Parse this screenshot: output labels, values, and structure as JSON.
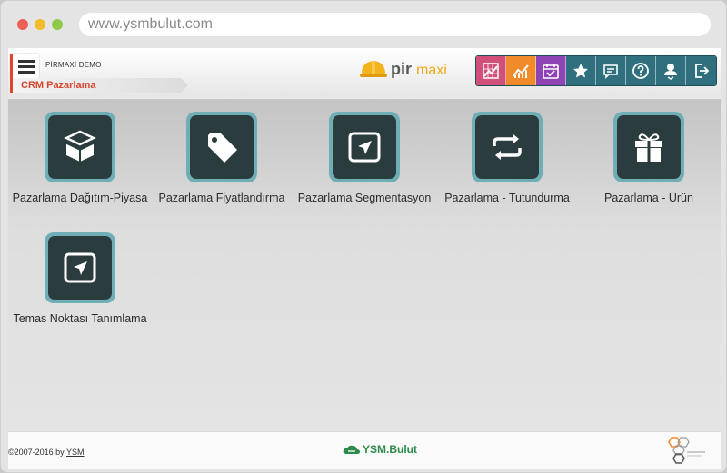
{
  "browser": {
    "url": "www.ysmbulut.com"
  },
  "header": {
    "company": "PİRMAXİ DEMO",
    "module_title": "CRM Pazarlama",
    "logo_primary": "pir",
    "logo_secondary": "maxi",
    "toolbar": [
      {
        "icon": "chart-grid-icon",
        "color": "#d0507a"
      },
      {
        "icon": "trend-chart-icon",
        "color": "#f08a2a"
      },
      {
        "icon": "calendar-check-icon",
        "color": "#8e44b5"
      },
      {
        "icon": "star-icon",
        "color": "#2f6f7e"
      },
      {
        "icon": "message-icon",
        "color": "#2f6f7e"
      },
      {
        "icon": "help-icon",
        "color": "#2f6f7e"
      },
      {
        "icon": "user-icon",
        "color": "#2f6f7e"
      },
      {
        "icon": "logout-icon",
        "color": "#2f6f7e"
      }
    ]
  },
  "tiles": [
    {
      "label": "Pazarlama Dağıtım-Piyasa",
      "icon": "box-distribution-icon"
    },
    {
      "label": "Pazarlama Fiyatlandırma",
      "icon": "price-tag-icon"
    },
    {
      "label": "Pazarlama Segmentasyon",
      "icon": "segment-pointer-icon"
    },
    {
      "label": "Pazarlama - Tutundurma",
      "icon": "repeat-icon"
    },
    {
      "label": "Pazarlama - Ürün",
      "icon": "gift-icon"
    },
    {
      "label": "Temas Noktası Tanımlama",
      "icon": "touchpoint-pointer-icon"
    }
  ],
  "footer": {
    "copyright_prefix": "©2007-2016 by ",
    "copyright_link": "YSM",
    "brand": "YSM.Bulut"
  },
  "colors": {
    "accent": "#e2442f",
    "tile_border": "#6faeb5",
    "tile_fill": "#2b3c3e",
    "footer_brand": "#2d8a4b"
  }
}
